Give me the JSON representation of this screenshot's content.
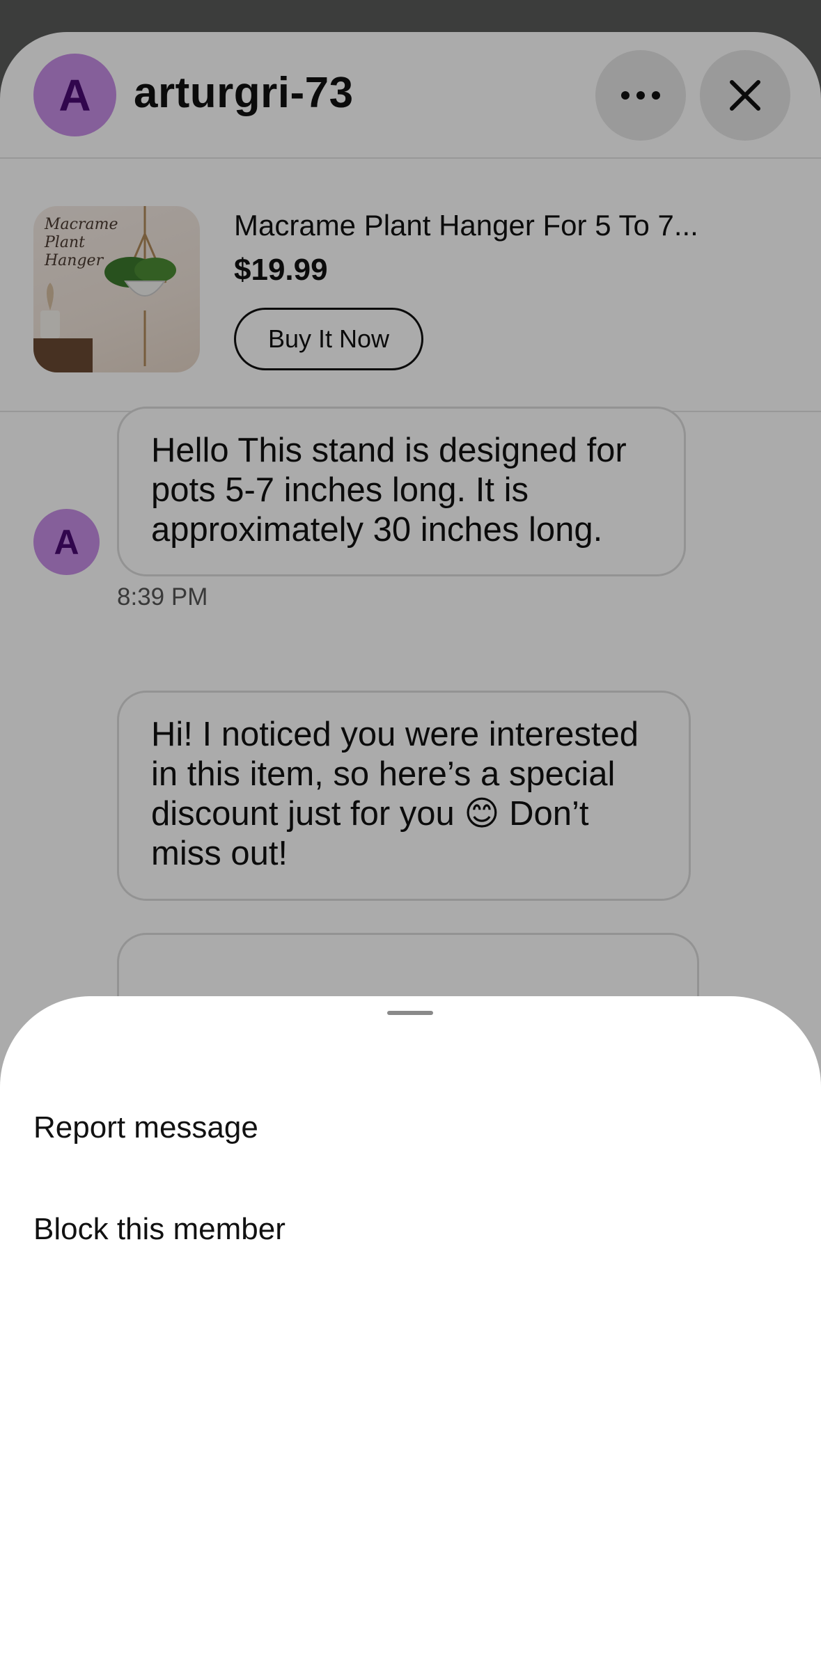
{
  "conversation": {
    "avatar_letter": "A",
    "username": "arturgri-73",
    "more_icon": "more-horizontal-icon",
    "close_icon": "close-icon"
  },
  "product": {
    "thumbnail_text": "Macrame Plant Hanger",
    "title": "Macrame Plant Hanger For 5 To 7...",
    "price": "$19.99",
    "buy_label": "Buy It Now"
  },
  "messages": [
    {
      "avatar_letter": "A",
      "text": "Hello This stand is designed for pots 5-7 inches long. It is approximately 30 inches long.",
      "time": "8:39 PM"
    },
    {
      "text": "Hi! I noticed you were interested in this item, so here’s a special discount just for you 😊 Don’t miss out!"
    }
  ],
  "action_sheet": {
    "items": [
      {
        "label": "Report message"
      },
      {
        "label": "Block this member"
      }
    ]
  },
  "colors": {
    "avatar_bg": "#c78ee6",
    "avatar_fg": "#4a0a73",
    "scrim": "rgba(0,0,0,0.33)"
  }
}
